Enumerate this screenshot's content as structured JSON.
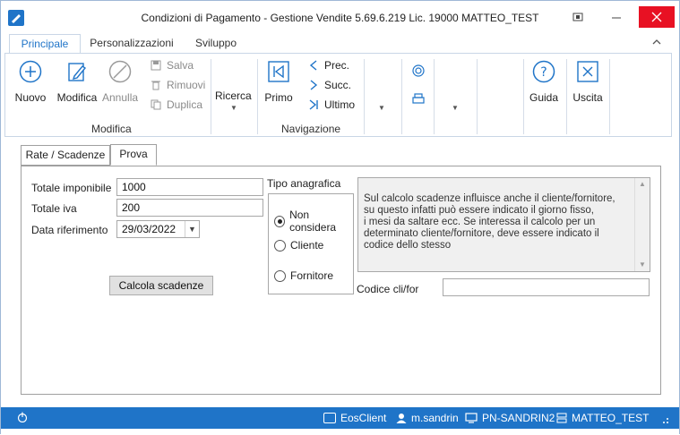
{
  "window": {
    "title": "Condizioni di Pagamento - Gestione Vendite 5.69.6.219 Lic. 19000 MATTEO_TEST",
    "controls": {
      "restore": "[ ]",
      "minimize": "—",
      "close": "✕"
    }
  },
  "ribbon_tabs": [
    {
      "label": "Principale",
      "active": true
    },
    {
      "label": "Personalizzazioni",
      "active": false
    },
    {
      "label": "Sviluppo",
      "active": false
    }
  ],
  "ribbon": {
    "nuovo": "Nuovo",
    "modifica": "Modifica",
    "annulla": "Annulla",
    "salva": "Salva",
    "rimuovi": "Rimuovi",
    "duplica": "Duplica",
    "ricerca": "Ricerca",
    "primo": "Primo",
    "prec": "Prec.",
    "succ": "Succ.",
    "ultimo": "Ultimo",
    "guida": "Guida",
    "uscita": "Uscita",
    "group_modifica": "Modifica",
    "group_navigazione": "Navigazione"
  },
  "content_tabs": [
    {
      "label": "Rate / Scadenze",
      "active": false
    },
    {
      "label": "Prova",
      "active": true
    }
  ],
  "form": {
    "totale_imponibile_label": "Totale imponibile",
    "totale_imponibile_value": "1000",
    "totale_iva_label": "Totale iva",
    "totale_iva_value": "200",
    "data_riferimento_label": "Data riferimento",
    "data_riferimento_value": "29/03/2022",
    "calcola_button": "Calcola scadenze",
    "tipo_anagrafica_label": "Tipo anagrafica",
    "radio_options": [
      {
        "label": "Non considera",
        "checked": true
      },
      {
        "label": "Cliente",
        "checked": false
      },
      {
        "label": "Fornitore",
        "checked": false
      }
    ],
    "info_text": "Sul calcolo scadenze influisce anche il cliente/fornitore,\n su questo infatti può essere indicato il giorno fisso,\n i mesi da saltare ecc. Se interessa il calcolo per un\n determinato cliente/fornitore, deve essere indicato il\n codice dello stesso",
    "codice_label": "Codice cli/for",
    "codice_value": ""
  },
  "statusbar": {
    "client": "EosClient",
    "user": "m.sandrin",
    "machine": "PN-SANDRIN2",
    "license": "MATTEO_TEST"
  },
  "colors": {
    "accent": "#1f74c8",
    "close": "#e81123"
  }
}
